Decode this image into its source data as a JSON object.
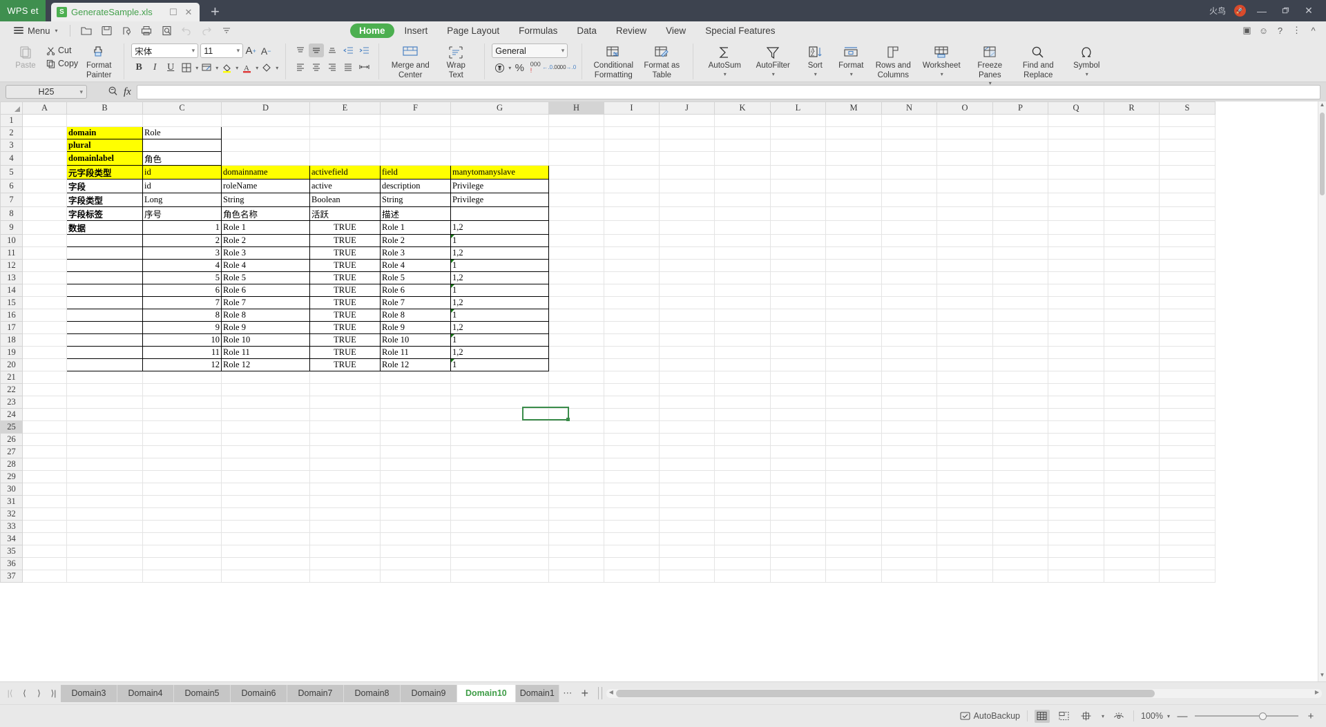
{
  "titlebar": {
    "app_badge": "WPS et",
    "doc_tab": {
      "name": "GenerateSample.xls",
      "icon": "spreadsheet-icon",
      "restore": "☐",
      "close": "✕"
    },
    "new_tab": "+",
    "user_name": "火鸟",
    "minimize": "—",
    "maximize": "❐",
    "close": "✕"
  },
  "menurow": {
    "menu_label": "Menu",
    "quick_icons": [
      "open-icon",
      "save-icon",
      "save-as-icon",
      "print-icon",
      "print-preview-icon",
      "undo-icon",
      "redo-icon",
      "customize-quick-access-icon"
    ],
    "tabs": [
      {
        "label": "Home",
        "active": true
      },
      {
        "label": "Insert",
        "active": false
      },
      {
        "label": "Page Layout",
        "active": false
      },
      {
        "label": "Formulas",
        "active": false
      },
      {
        "label": "Data",
        "active": false
      },
      {
        "label": "Review",
        "active": false
      },
      {
        "label": "View",
        "active": false
      },
      {
        "label": "Special Features",
        "active": false
      }
    ],
    "right_icons": [
      "presentation-icon",
      "comment-icon",
      "help-icon",
      "more-icon",
      "collapse-ribbon-icon"
    ]
  },
  "ribbon": {
    "paste": "Paste",
    "cut": "Cut",
    "copy": "Copy",
    "format_painter_l1": "Format",
    "format_painter_l2": "Painter",
    "font_name": "宋体",
    "font_size": "11",
    "grow_font": "A",
    "shrink_font": "A",
    "bold": "B",
    "italic": "I",
    "underline": "U",
    "merge_l1": "Merge and",
    "merge_l2": "Center",
    "wrap_l1": "Wrap",
    "wrap_l2": "Text",
    "number_format": "General",
    "percent": "%",
    "comma": "000",
    "dec_increase": "←.0",
    "dec_decrease": ".00",
    "conditional_l1": "Conditional",
    "conditional_l2": "Formatting",
    "format_table_l1": "Format as",
    "format_table_l2": "Table",
    "autosum": "AutoSum",
    "autofilter": "AutoFilter",
    "sort": "Sort",
    "format": "Format",
    "rows_l1": "Rows and",
    "rows_l2": "Columns",
    "worksheet": "Worksheet",
    "freeze_panes": "Freeze Panes",
    "find_l1": "Find and",
    "find_l2": "Replace",
    "symbol": "Symbol"
  },
  "formulabar": {
    "name_box": "H25",
    "search_icon": "search-icon",
    "fx_icon": "fx",
    "formula_value": ""
  },
  "grid": {
    "columns": [
      "A",
      "B",
      "C",
      "D",
      "E",
      "F",
      "G",
      "H",
      "I",
      "J",
      "K",
      "L",
      "M",
      "N",
      "O",
      "P",
      "Q",
      "R",
      "S"
    ],
    "selected_column": "H",
    "selected_row": 25,
    "selected_cell": "H25",
    "first_row": 1,
    "last_row": 37,
    "cells": {
      "B2": "domain",
      "C2": "Role",
      "B3": "plural",
      "C3": "",
      "B4": "domainlabel",
      "C4": "角色",
      "B5": "元字段类型",
      "C5": "id",
      "D5": "domainname",
      "E5": "activefield",
      "F5": "field",
      "G5": "manytomanyslave",
      "B6": "字段",
      "C6": "id",
      "D6": "roleName",
      "E6": "active",
      "F6": "description",
      "G6": "Privilege",
      "B7": "字段类型",
      "C7": "Long",
      "D7": "String",
      "E7": "Boolean",
      "F7": "String",
      "G7": "Privilege",
      "B8": "字段标签",
      "C8": "序号",
      "D8": "角色名称",
      "E8": "活跃",
      "F8": "描述",
      "G8": "",
      "B9": "数据"
    },
    "data_rows": [
      {
        "row": 9,
        "id": "1",
        "name": "Role 1",
        "active": "TRUE",
        "desc": "Role 1",
        "priv": "1,2",
        "tri": false
      },
      {
        "row": 10,
        "id": "2",
        "name": "Role 2",
        "active": "TRUE",
        "desc": "Role 2",
        "priv": "1",
        "tri": true
      },
      {
        "row": 11,
        "id": "3",
        "name": "Role 3",
        "active": "TRUE",
        "desc": "Role 3",
        "priv": "1,2",
        "tri": false
      },
      {
        "row": 12,
        "id": "4",
        "name": "Role 4",
        "active": "TRUE",
        "desc": "Role 4",
        "priv": "1",
        "tri": true
      },
      {
        "row": 13,
        "id": "5",
        "name": "Role 5",
        "active": "TRUE",
        "desc": "Role 5",
        "priv": "1,2",
        "tri": false
      },
      {
        "row": 14,
        "id": "6",
        "name": "Role 6",
        "active": "TRUE",
        "desc": "Role 6",
        "priv": "1",
        "tri": true
      },
      {
        "row": 15,
        "id": "7",
        "name": "Role 7",
        "active": "TRUE",
        "desc": "Role 7",
        "priv": "1,2",
        "tri": false
      },
      {
        "row": 16,
        "id": "8",
        "name": "Role 8",
        "active": "TRUE",
        "desc": "Role 8",
        "priv": "1",
        "tri": true
      },
      {
        "row": 17,
        "id": "9",
        "name": "Role 9",
        "active": "TRUE",
        "desc": "Role 9",
        "priv": "1,2",
        "tri": false
      },
      {
        "row": 18,
        "id": "10",
        "name": "Role 10",
        "active": "TRUE",
        "desc": "Role 10",
        "priv": "1",
        "tri": true
      },
      {
        "row": 19,
        "id": "11",
        "name": "Role 11",
        "active": "TRUE",
        "desc": "Role 11",
        "priv": "1,2",
        "tri": false
      },
      {
        "row": 20,
        "id": "12",
        "name": "Role 12",
        "active": "TRUE",
        "desc": "Role 12",
        "priv": "1",
        "tri": true
      }
    ],
    "highlight_color": "#ffff00"
  },
  "sheetbar": {
    "nav": [
      "first-sheet-icon",
      "prev-sheet-icon",
      "next-sheet-icon",
      "last-sheet-icon"
    ],
    "tabs": [
      {
        "label": "Domain3",
        "active": false
      },
      {
        "label": "Domain4",
        "active": false
      },
      {
        "label": "Domain5",
        "active": false
      },
      {
        "label": "Domain6",
        "active": false
      },
      {
        "label": "Domain7",
        "active": false
      },
      {
        "label": "Domain8",
        "active": false
      },
      {
        "label": "Domain9",
        "active": false
      },
      {
        "label": "Domain10",
        "active": true
      },
      {
        "label": "Domain1",
        "active": false
      }
    ],
    "more": "⋯",
    "add": "+"
  },
  "statusbar": {
    "autobackup": "AutoBackup",
    "view_normal": "normal-view-icon",
    "view_pagebreak": "page-break-view-icon",
    "view_layout": "page-layout-icon",
    "view_eye": "reading-layout-icon",
    "zoom": "100%",
    "zoom_out": "—",
    "zoom_in": "+"
  }
}
